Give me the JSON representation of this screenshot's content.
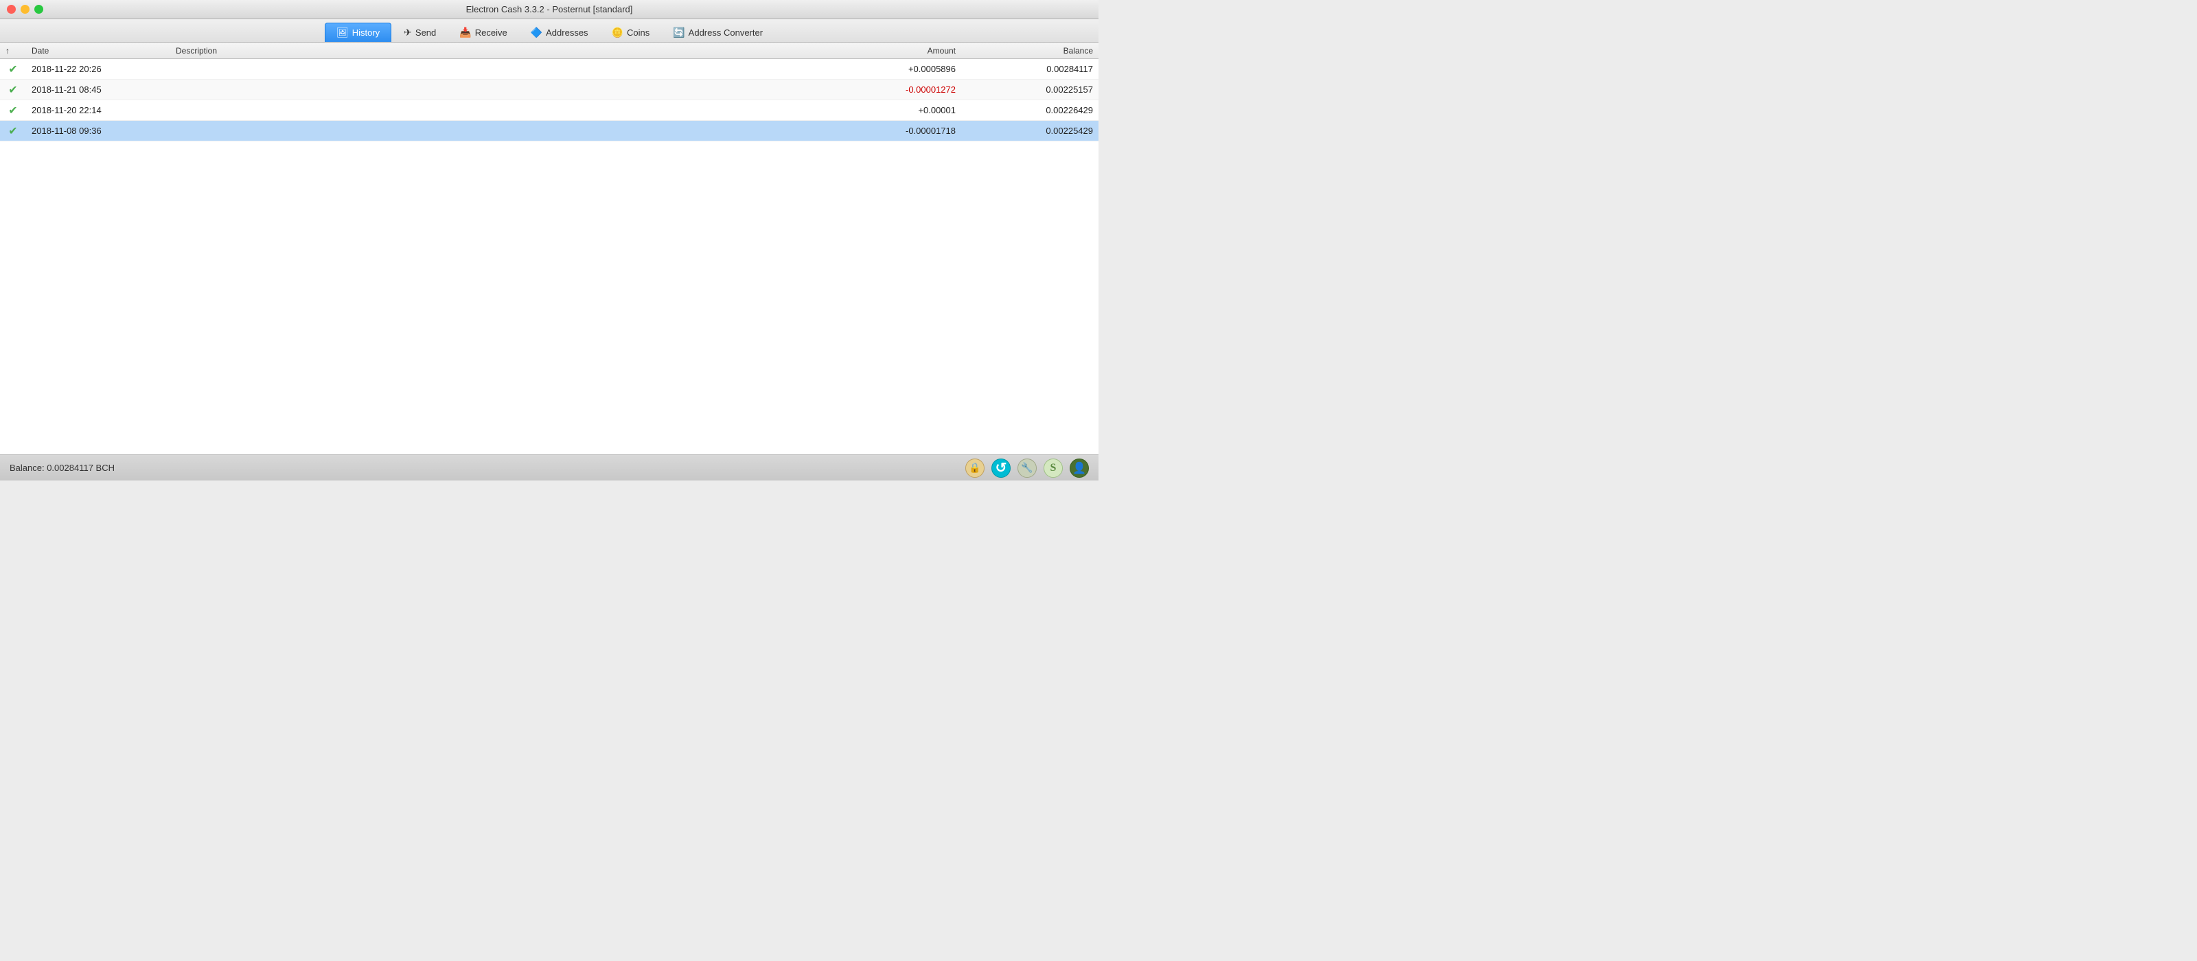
{
  "titleBar": {
    "title": "Electron Cash 3.3.2  -  Posternut  [standard]"
  },
  "tabs": [
    {
      "id": "history",
      "label": "History",
      "icon": "🖼",
      "active": true
    },
    {
      "id": "send",
      "label": "Send",
      "icon": "✈",
      "active": false
    },
    {
      "id": "receive",
      "label": "Receive",
      "icon": "📥",
      "active": false
    },
    {
      "id": "addresses",
      "label": "Addresses",
      "icon": "🔷",
      "active": false
    },
    {
      "id": "coins",
      "label": "Coins",
      "icon": "🪙",
      "active": false
    },
    {
      "id": "address-converter",
      "label": "Address Converter",
      "icon": "🔄",
      "active": false
    }
  ],
  "tableHeaders": {
    "sort": "↑",
    "date": "Date",
    "description": "Description",
    "amount": "Amount",
    "balance": "Balance"
  },
  "tableRows": [
    {
      "checked": true,
      "date": "2018-11-22 20:26",
      "description": "",
      "amount": "+0.0005896",
      "amountType": "positive",
      "balance": "0.00284117",
      "selected": false
    },
    {
      "checked": true,
      "date": "2018-11-21 08:45",
      "description": "",
      "amount": "-0.00001272",
      "amountType": "negative",
      "balance": "0.00225157",
      "selected": false
    },
    {
      "checked": true,
      "date": "2018-11-20 22:14",
      "description": "",
      "amount": "+0.00001",
      "amountType": "positive",
      "balance": "0.00226429",
      "selected": false
    },
    {
      "checked": true,
      "date": "2018-11-08 09:36",
      "description": "",
      "amount": "-0.00001718",
      "amountType": "negative-dark",
      "balance": "0.00225429",
      "selected": true
    }
  ],
  "statusBar": {
    "balance": "Balance: 0.00284117 BCH"
  },
  "icons": {
    "lock": "🔒",
    "sync": "↺",
    "tools": "🔧",
    "dollar": "S",
    "person": "👤"
  }
}
